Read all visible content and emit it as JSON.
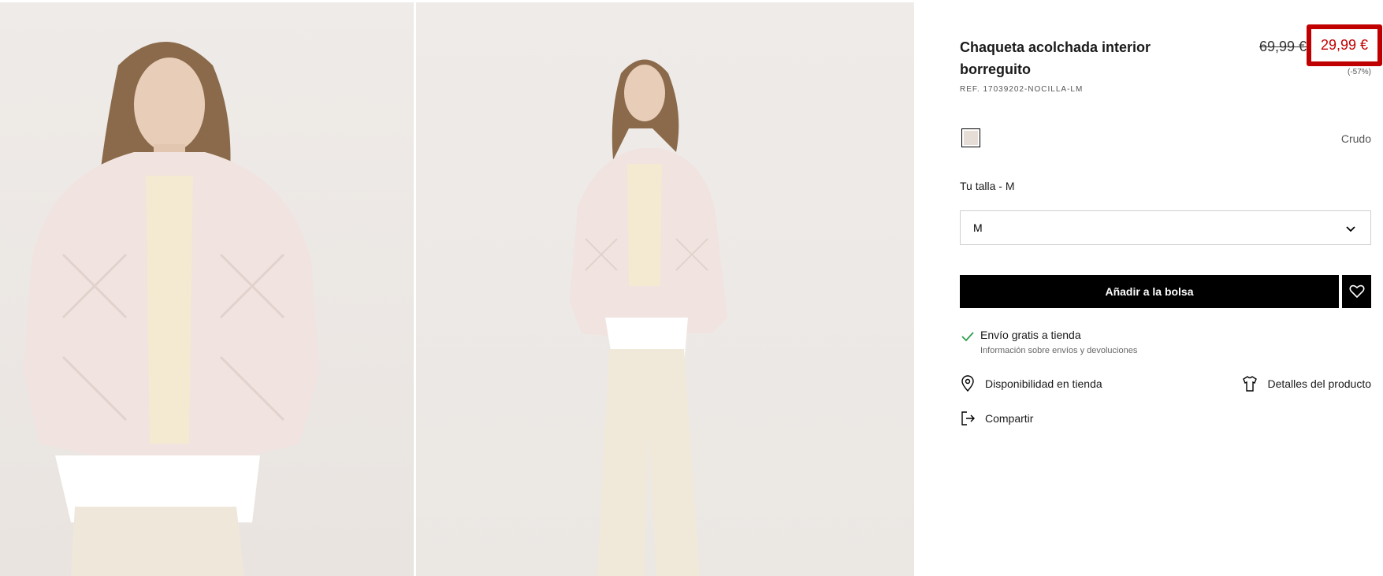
{
  "product": {
    "title": "Chaqueta acolchada interior borreguito",
    "ref": "REF. 17039202-NOCILLA-LM",
    "old_price": "69,99 €",
    "new_price": "29,99 €",
    "discount": "(-57%)",
    "accent_color": "#c00000"
  },
  "color": {
    "name": "Crudo",
    "swatch_hex": "#e6ddd6"
  },
  "size": {
    "label": "Tu talla - M",
    "selected": "M"
  },
  "actions": {
    "add_to_bag": "Añadir a la bolsa",
    "wishlist_icon": "heart-icon"
  },
  "shipping": {
    "title": "Envío gratis a tienda",
    "subtitle": "Información sobre envíos y devoluciones",
    "icon": "check-icon",
    "icon_color": "#2e9e4f"
  },
  "links": {
    "store_availability": "Disponibilidad en tienda",
    "product_details": "Detalles del producto",
    "share": "Compartir"
  },
  "gallery": {
    "images": [
      "product-photo-front-closeup",
      "product-photo-full-body"
    ]
  }
}
